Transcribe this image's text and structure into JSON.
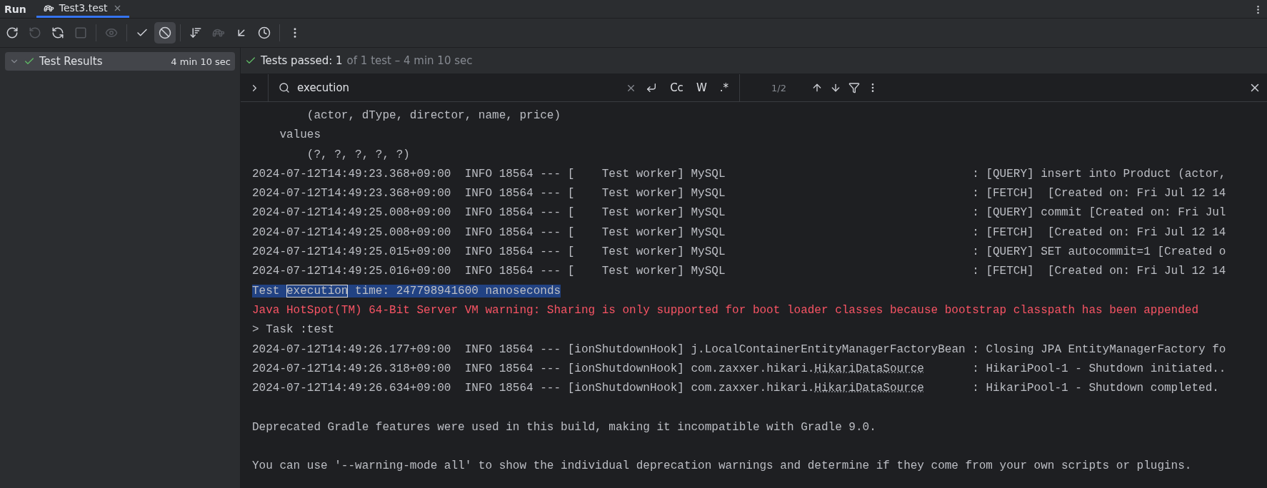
{
  "title_bar": {
    "label": "Run",
    "tabs": [
      {
        "label": "Test3.test",
        "selected": true
      }
    ]
  },
  "toolbar": [
    {
      "disabled": false,
      "selected": false
    },
    {
      "disabled": true,
      "selected": false
    },
    {
      "disabled": false,
      "selected": false
    },
    {
      "disabled": true,
      "selected": false
    },
    {
      "disabled": true,
      "selected": false
    },
    {
      "disabled": false,
      "selected": false
    },
    {
      "disabled": false,
      "selected": true
    },
    {
      "disabled": false,
      "selected": false
    },
    {
      "disabled": true,
      "selected": false
    },
    {
      "disabled": false,
      "selected": false
    },
    {
      "disabled": false,
      "selected": false
    },
    {
      "disabled": false,
      "selected": false
    }
  ],
  "test_tree": [
    {
      "label": "Test Results",
      "time": "4 min 10 sec",
      "expanded": true,
      "selected": true
    }
  ],
  "summary": {
    "status": "Tests passed: 1",
    "detail": "of 1 test – 4 min 10 sec"
  },
  "search": {
    "value": "execution",
    "options": [
      "Cc",
      "W",
      ".*"
    ],
    "count": "1/2"
  },
  "console": [
    {
      "kind": "text",
      "text": "        (actor, dType, director, name, price)"
    },
    {
      "kind": "text",
      "text": "    values"
    },
    {
      "kind": "text",
      "text": "        (?, ?, ?, ?, ?)"
    },
    {
      "kind": "log",
      "head": "2024-07-12T14:49:23.368+09:00  INFO 18564 --- [    Test worker]",
      "logger": "MySQL",
      "message": ": [QUERY] insert into Product (actor,"
    },
    {
      "kind": "log",
      "head": "2024-07-12T14:49:23.368+09:00  INFO 18564 --- [    Test worker]",
      "logger": "MySQL",
      "message": ": [FETCH]  [Created on: Fri Jul 12 14"
    },
    {
      "kind": "log",
      "head": "2024-07-12T14:49:25.008+09:00  INFO 18564 --- [    Test worker]",
      "logger": "MySQL",
      "message": ": [QUERY] commit [Created on: Fri Jul"
    },
    {
      "kind": "log",
      "head": "2024-07-12T14:49:25.008+09:00  INFO 18564 --- [    Test worker]",
      "logger": "MySQL",
      "message": ": [FETCH]  [Created on: Fri Jul 12 14"
    },
    {
      "kind": "log",
      "head": "2024-07-12T14:49:25.015+09:00  INFO 18564 --- [    Test worker]",
      "logger": "MySQL",
      "message": ": [QUERY] SET autocommit=1 [Created o"
    },
    {
      "kind": "log",
      "head": "2024-07-12T14:49:25.016+09:00  INFO 18564 --- [    Test worker]",
      "logger": "MySQL",
      "message": ": [FETCH]  [Created on: Fri Jul 12 14"
    },
    {
      "kind": "match",
      "before": "Test ",
      "match": "execution",
      "after": " time: 247798941600 nanoseconds",
      "selected": true
    },
    {
      "kind": "error",
      "text": "Java HotSpot(TM) 64-Bit Server VM warning: Sharing is only supported for boot loader classes because bootstrap classpath has been appended"
    },
    {
      "kind": "text",
      "text": "> Task :test"
    },
    {
      "kind": "log",
      "head": "2024-07-12T14:49:26.177+09:00  INFO 18564 --- [ionShutdownHook]",
      "logger": "j.LocalContainerEntityManagerFactoryBean",
      "message": ": Closing JPA EntityManagerFactory fo"
    },
    {
      "kind": "log",
      "head": "2024-07-12T14:49:26.318+09:00  INFO 18564 --- [ionShutdownHook]",
      "logger": "com.zaxxer.hikari.",
      "logger_link": "HikariDataSource",
      "message": ": HikariPool-1 - Shutdown initiated.."
    },
    {
      "kind": "log",
      "head": "2024-07-12T14:49:26.634+09:00  INFO 18564 --- [ionShutdownHook]",
      "logger": "com.zaxxer.hikari.",
      "logger_link": "HikariDataSource",
      "message": ": HikariPool-1 - Shutdown completed."
    },
    {
      "kind": "blank"
    },
    {
      "kind": "text",
      "text": "Deprecated Gradle features were used in this build, making it incompatible with Gradle 9.0."
    },
    {
      "kind": "blank"
    },
    {
      "kind": "text",
      "text": "You can use '--warning-mode all' to show the individual deprecation warnings and determine if they come from your own scripts or plugins."
    }
  ]
}
